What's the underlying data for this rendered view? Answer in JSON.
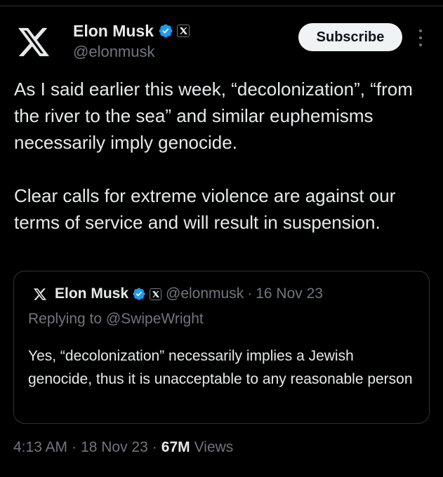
{
  "author": {
    "display_name": "Elon Musk",
    "handle": "@elonmusk",
    "logo_icon": "x-logo-icon",
    "verified_icon": "verified-badge-icon",
    "verified_color": "#1d9bf0"
  },
  "header": {
    "subscribe_label": "Subscribe",
    "more_icon": "more-vertical-icon"
  },
  "tweet": {
    "text": "As I said earlier this week, “decolonization”, “from the river to the sea” and similar euphemisms necessarily imply genocide.\n\nClear calls for extreme violence are against our terms of service and will result in suspension."
  },
  "quoted_tweet": {
    "display_name": "Elon Musk",
    "handle": "@elonmusk",
    "separator": "·",
    "date": "16 Nov 23",
    "replying_to": "Replying to @SwipeWright",
    "text": "Yes, “decolonization” necessarily implies a Jewish genocide, thus it is unacceptable to any reasonable person"
  },
  "meta": {
    "time": "4:13 AM",
    "separator": "·",
    "date": "18 Nov 23",
    "views_count": "67M",
    "views_label": "Views"
  },
  "colors": {
    "background": "#000000",
    "text_primary": "#e7e9ea",
    "text_secondary": "#71767b",
    "border": "#2f3336",
    "button_bg": "#eff3f4",
    "accent": "#1d9bf0"
  }
}
